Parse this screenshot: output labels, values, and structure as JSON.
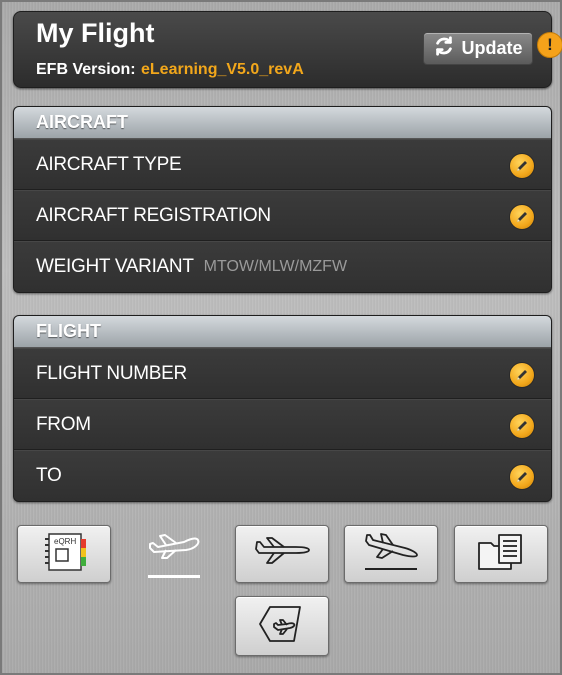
{
  "header": {
    "title": "My Flight",
    "version_label": "EFB Version:",
    "version_value": "eLearning_V5.0_revA",
    "update_label": "Update",
    "alert_symbol": "!"
  },
  "aircraft": {
    "heading": "AIRCRAFT",
    "rows": [
      {
        "label": "AIRCRAFT TYPE",
        "icon": "pencil-icon"
      },
      {
        "label": "AIRCRAFT REGISTRATION",
        "icon": "pencil-icon"
      },
      {
        "label": "WEIGHT VARIANT",
        "hint": "MTOW/MLW/MZFW"
      }
    ]
  },
  "flight": {
    "heading": "FLIGHT",
    "rows": [
      {
        "label": "FLIGHT NUMBER",
        "icon": "pencil-icon"
      },
      {
        "label": "FROM",
        "icon": "pencil-icon"
      },
      {
        "label": "TO",
        "icon": "pencil-icon"
      }
    ]
  },
  "toolbar": {
    "eqrh_label": "eQRH",
    "items": [
      "eqrh-icon",
      "takeoff-icon",
      "cruise-icon",
      "landing-icon",
      "documents-icon",
      "loadsheet-icon"
    ],
    "active": "takeoff-icon"
  },
  "colors": {
    "accent": "#f2a71b",
    "panel": "#343434",
    "header": "#2c2c2c"
  }
}
